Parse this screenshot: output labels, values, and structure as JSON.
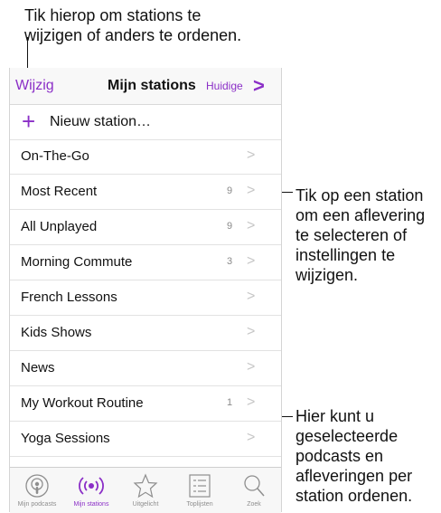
{
  "callouts": {
    "top": [
      "Tik hierop om stations te",
      "wijzigen of anders te ordenen."
    ],
    "station": [
      "Tik op een station",
      "om een aflevering",
      "te selecteren of",
      "instellingen te",
      "wijzigen."
    ],
    "reorder": [
      "Hier kunt u",
      "geselecteerde",
      "podcasts en",
      "afleveringen per",
      "station ordenen."
    ]
  },
  "navbar": {
    "left": "Wijzig",
    "title": "Mijn stations",
    "right": "Huidige",
    "chevron": ">"
  },
  "new_station": {
    "icon": "+",
    "label": "Nieuw station…"
  },
  "stations": [
    {
      "label": "On-The-Go",
      "count": ""
    },
    {
      "label": "Most Recent",
      "count": "9"
    },
    {
      "label": "All Unplayed",
      "count": "9"
    },
    {
      "label": "Morning Commute",
      "count": "3"
    },
    {
      "label": "French Lessons",
      "count": ""
    },
    {
      "label": "Kids Shows",
      "count": ""
    },
    {
      "label": "News",
      "count": ""
    },
    {
      "label": "My Workout Routine",
      "count": "1"
    },
    {
      "label": "Yoga Sessions",
      "count": ""
    }
  ],
  "chevron": ">",
  "tabs": [
    {
      "label": "Mijn podcasts",
      "icon": "podcast-icon",
      "active": false
    },
    {
      "label": "Mijn stations",
      "icon": "station-icon",
      "active": true
    },
    {
      "label": "Uitgelicht",
      "icon": "star-icon",
      "active": false
    },
    {
      "label": "Toplijsten",
      "icon": "list-icon",
      "active": false
    },
    {
      "label": "Zoek",
      "icon": "search-icon",
      "active": false
    }
  ],
  "colors": {
    "accent": "#8b2fc7",
    "chevron": "#c6c6c6",
    "count": "#8a8a8a"
  }
}
